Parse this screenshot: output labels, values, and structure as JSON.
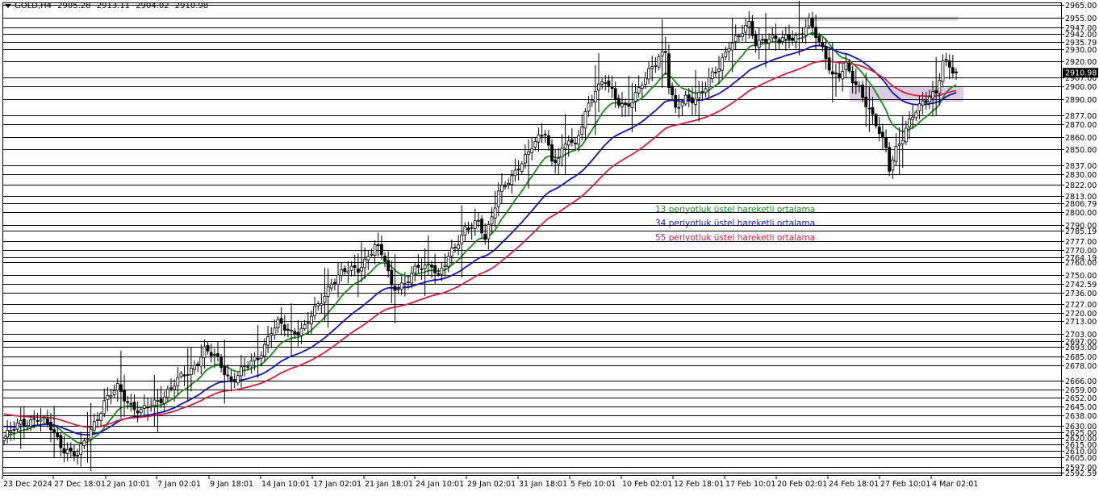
{
  "header": {
    "symbol": "GOLD,H4",
    "open": "2905.28",
    "high": "2913.11",
    "low": "2904.02",
    "close": "2910.98"
  },
  "legend": [
    {
      "text": "13 periyotluk üstel hareketli ortalama",
      "color": "#1a8a1a"
    },
    {
      "text": "34 periyotluk üstel hareketli ortalama",
      "color": "#1212b8"
    },
    {
      "text": "55 periyotluk üstel hareketli ortalama",
      "color": "#d21e3c"
    }
  ],
  "colors": {
    "candle": "#000000",
    "grid_line": "#000000",
    "ema13": "#1a8a1a",
    "ema34": "#1212b8",
    "ema55": "#d21e3c",
    "resistance_zone": "#d6d6d6",
    "support_zone": "#d7c6de",
    "price_box": "#000000",
    "price_text": "#ffffff"
  },
  "chart_data": {
    "type": "candlestick",
    "x_labels": [
      "23 Dec 2024",
      "27 Dec 18:01",
      "2 Jan 10:01",
      "7 Jan 02:01",
      "9 Jan 18:01",
      "14 Jan 10:01",
      "17 Jan 02:01",
      "21 Jan 18:01",
      "24 Jan 10:01",
      "29 Jan 02:01",
      "31 Jan 18:01",
      "5 Feb 10:01",
      "10 Feb 02:01",
      "12 Feb 18:01",
      "17 Feb 10:01",
      "20 Feb 02:01",
      "24 Feb 18:01",
      "27 Feb 10:01",
      "4 Mar 02:01"
    ],
    "ylim": [
      2590,
      2967
    ],
    "horizontal_levels": [
      "2965.00",
      "2955.00",
      "2947.00",
      "2942.00",
      "2935.79",
      "2930.00",
      "2920.00",
      "2907.00",
      "2900.00",
      "2890.00",
      "2877.00",
      "2870.00",
      "2860.00",
      "2850.00",
      "2837.00",
      "2830.00",
      "2822.00",
      "2813.00",
      "2806.79",
      "2800.00",
      "2790.00",
      "2785.19",
      "2777.00",
      "2770.00",
      "2764.19",
      "2760.00",
      "2750.00",
      "2742.59",
      "2736.00",
      "2727.00",
      "2720.00",
      "2713.00",
      "2703.00",
      "2697.00",
      "2693.00",
      "2685.00",
      "2678.00",
      "2666.00",
      "2659.00",
      "2652.00",
      "2645.00",
      "2638.00",
      "2630.00",
      "2625.00",
      "2620.00",
      "2615.00",
      "2610.00",
      "2605.00",
      "2597.00",
      "2592.59"
    ],
    "current_price": "2910.98",
    "current_price_value": 2910.98,
    "resistance_zone": [
      2953,
      2955
    ],
    "support_zone": [
      2888,
      2900
    ],
    "anchors": [
      [
        0,
        2620
      ],
      [
        5,
        2632
      ],
      [
        10,
        2636
      ],
      [
        14,
        2628
      ],
      [
        18,
        2612
      ],
      [
        22,
        2605
      ],
      [
        26,
        2628
      ],
      [
        30,
        2648
      ],
      [
        34,
        2660
      ],
      [
        38,
        2647
      ],
      [
        41,
        2640
      ],
      [
        44,
        2646
      ],
      [
        48,
        2655
      ],
      [
        52,
        2665
      ],
      [
        56,
        2675
      ],
      [
        60,
        2690
      ],
      [
        64,
        2682
      ],
      [
        68,
        2666
      ],
      [
        72,
        2675
      ],
      [
        76,
        2685
      ],
      [
        80,
        2705
      ],
      [
        82,
        2710
      ],
      [
        86,
        2705
      ],
      [
        90,
        2708
      ],
      [
        94,
        2725
      ],
      [
        98,
        2745
      ],
      [
        102,
        2752
      ],
      [
        106,
        2756
      ],
      [
        108,
        2762
      ],
      [
        111,
        2772
      ],
      [
        114,
        2762
      ],
      [
        116,
        2742
      ],
      [
        120,
        2742
      ],
      [
        124,
        2756
      ],
      [
        128,
        2760
      ],
      [
        130,
        2748
      ],
      [
        134,
        2768
      ],
      [
        138,
        2788
      ],
      [
        142,
        2790
      ],
      [
        144,
        2778
      ],
      [
        148,
        2818
      ],
      [
        152,
        2825
      ],
      [
        156,
        2845
      ],
      [
        158,
        2855
      ],
      [
        162,
        2862
      ],
      [
        164,
        2838
      ],
      [
        166,
        2846
      ],
      [
        169,
        2860
      ],
      [
        171,
        2850
      ],
      [
        174,
        2878
      ],
      [
        177,
        2900
      ],
      [
        180,
        2905
      ],
      [
        183,
        2888
      ],
      [
        186,
        2885
      ],
      [
        190,
        2897
      ],
      [
        193,
        2910
      ],
      [
        196,
        2925
      ],
      [
        198,
        2930
      ],
      [
        199,
        2902
      ],
      [
        201,
        2880
      ],
      [
        204,
        2890
      ],
      [
        207,
        2892
      ],
      [
        210,
        2900
      ],
      [
        214,
        2915
      ],
      [
        217,
        2935
      ],
      [
        220,
        2940
      ],
      [
        223,
        2948
      ],
      [
        225,
        2935
      ],
      [
        228,
        2940
      ],
      [
        232,
        2935
      ],
      [
        235,
        2940
      ],
      [
        238,
        2942
      ],
      [
        241,
        2950
      ],
      [
        243,
        2940
      ],
      [
        246,
        2925
      ],
      [
        248,
        2910
      ],
      [
        250,
        2908
      ],
      [
        252,
        2915
      ],
      [
        254,
        2905
      ],
      [
        256,
        2900
      ],
      [
        258,
        2888
      ],
      [
        260,
        2875
      ],
      [
        262,
        2862
      ],
      [
        264,
        2850
      ],
      [
        265,
        2836
      ],
      [
        267,
        2852
      ],
      [
        269,
        2860
      ],
      [
        271,
        2870
      ],
      [
        273,
        2880
      ],
      [
        275,
        2888
      ],
      [
        277,
        2895
      ],
      [
        279,
        2895
      ],
      [
        281,
        2918
      ],
      [
        283,
        2915
      ],
      [
        285,
        2910
      ]
    ],
    "series": [
      {
        "name": "13 periyotluk üstel hareketli ortalama",
        "period": 13,
        "color": "#1a8a1a"
      },
      {
        "name": "34 periyotluk üstel hareketli ortalama",
        "period": 34,
        "color": "#1212b8"
      },
      {
        "name": "55 periyotluk üstel hareketli ortalama",
        "period": 55,
        "color": "#d21e3c"
      }
    ],
    "ema_seeds": [
      2622,
      2630,
      2640
    ]
  }
}
